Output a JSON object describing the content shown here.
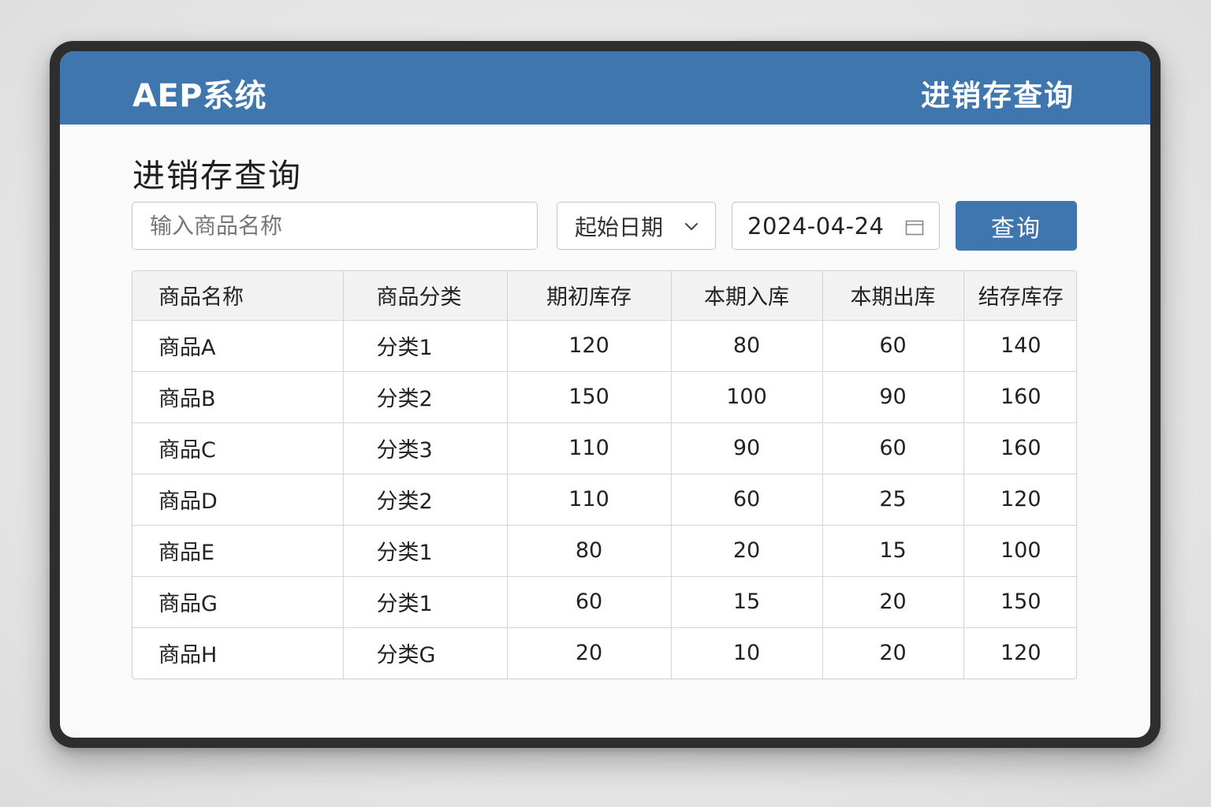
{
  "app": {
    "brand": "AEP系统",
    "header_page": "进销存查询"
  },
  "page": {
    "title": "进销存查询"
  },
  "filters": {
    "search_placeholder": "输入商品名称",
    "search_value": "",
    "date_mode": "起始日期",
    "date_value": "2024-04-24",
    "query_label": "查询"
  },
  "icons": {
    "date_mode": "chevron-down-icon",
    "date_value": "calendar-icon"
  },
  "colors": {
    "primary": "#3e76ad",
    "header_bg": "#3e76ad",
    "table_header_bg": "#f2f2f2"
  },
  "table": {
    "columns": [
      "商品名称",
      "商品分类",
      "期初库存",
      "本期入库",
      "本期出库",
      "结存库存"
    ],
    "rows": [
      [
        "商品A",
        "分类1",
        "120",
        "80",
        "60",
        "140"
      ],
      [
        "商品B",
        "分类2",
        "150",
        "100",
        "90",
        "160"
      ],
      [
        "商品C",
        "分类3",
        "110",
        "90",
        "60",
        "160"
      ],
      [
        "商品D",
        "分类2",
        "110",
        "60",
        "25",
        "120"
      ],
      [
        "商品E",
        "分类1",
        "80",
        "20",
        "15",
        "100"
      ],
      [
        "商品G",
        "分类1",
        "60",
        "15",
        "20",
        "150"
      ],
      [
        "商品H",
        "分类G",
        "20",
        "10",
        "20",
        "120"
      ]
    ]
  }
}
